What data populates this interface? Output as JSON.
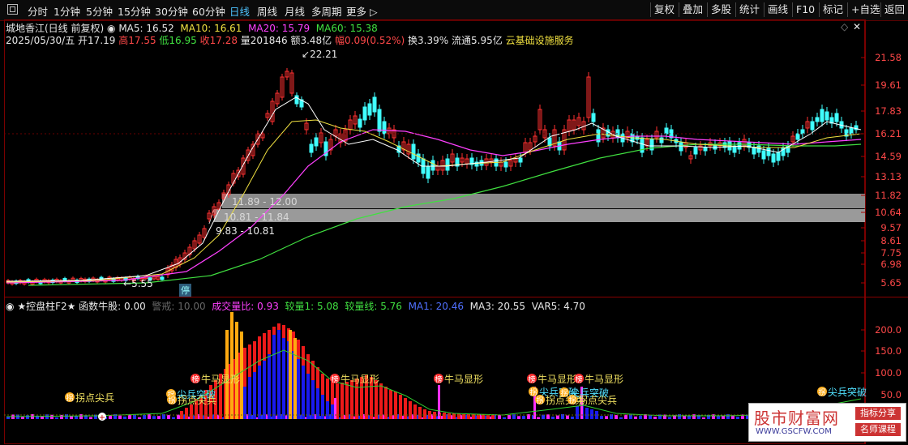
{
  "toolbar": {
    "tabs": [
      {
        "label": "分时",
        "active": false
      },
      {
        "label": "1分钟",
        "active": false
      },
      {
        "label": "5分钟",
        "active": false
      },
      {
        "label": "15分钟",
        "active": false
      },
      {
        "label": "30分钟",
        "active": false
      },
      {
        "label": "60分钟",
        "active": false
      },
      {
        "label": "日线",
        "active": true
      },
      {
        "label": "周线",
        "active": false
      },
      {
        "label": "月线",
        "active": false
      },
      {
        "label": "多周期",
        "active": false
      },
      {
        "label": "更多",
        "active": false
      }
    ],
    "right_buttons": [
      "复权",
      "叠加",
      "多股",
      "统计",
      "画线",
      "F10",
      "标记",
      "+自选",
      "返回"
    ]
  },
  "header": {
    "stock_title": "城地香江(日线 前复权)",
    "ma5": "MA5: 16.52",
    "ma10": "MA10: 16.61",
    "ma20": "MA20: 15.79",
    "ma60": "MA60: 15.38",
    "date": "2025/05/30/五",
    "open": "开17.19",
    "high": "高17.55",
    "low": "低16.95",
    "close": "收17.28",
    "volume": "量201846",
    "amount": "额3.48亿",
    "change": "幅0.09(0.52%)",
    "turnover": "换3.39%",
    "float_cap": "流通5.95亿",
    "sector": "云基础设施服务"
  },
  "price_chart": {
    "max_label": "22.21",
    "min_label": "5.55",
    "band1_label": "11.89 - 12.00",
    "band2_label": "10.81 - 11.84",
    "band3_label": "9.83 - 10.81",
    "halt_label": "停",
    "y_ticks": [
      "21.58",
      "19.61",
      "17.83",
      "16.21",
      "14.59",
      "13.13",
      "11.82",
      "10.64",
      "9.57",
      "8.61",
      "7.75",
      "6.98",
      "5.65"
    ]
  },
  "indicator": {
    "title": "★控盘柱F2★ 函数牛股: 0.00",
    "warn": "警戒: 10.00",
    "vol_ratio": "成交量比: 0.93",
    "jl1": "较量1: 5.08",
    "jlx": "较量线: 5.76",
    "ma1": "MA1: 20.46",
    "ma3": "MA3: 20.55",
    "var5": "VAR5: 4.70",
    "y_ticks": [
      "200.0",
      "150.0",
      "100.0",
      "50.0"
    ],
    "signals": [
      "拐点尖兵",
      "尖兵突破",
      "拐点尖兵",
      "牛马显形",
      "牛马显形",
      "牛马显形",
      "牛马显形",
      "尖兵突破",
      "拐点尖兵",
      "牛马显形",
      "尖兵突破",
      "拐点尖兵",
      "尖兵突破"
    ],
    "badge_chars": {
      "bang": "榜",
      "gong": "拐"
    }
  },
  "watermark": {
    "title": "股市财富网",
    "url": "WWW.GSCFW.COM",
    "tag1": "指标分享",
    "tag2": "名师课程"
  },
  "colors": {
    "up": "#ff3030",
    "down": "#40ffff",
    "ma5": "#ffffff",
    "ma10": "#f0e040",
    "ma20": "#ff40ff",
    "ma60": "#40e040"
  }
}
